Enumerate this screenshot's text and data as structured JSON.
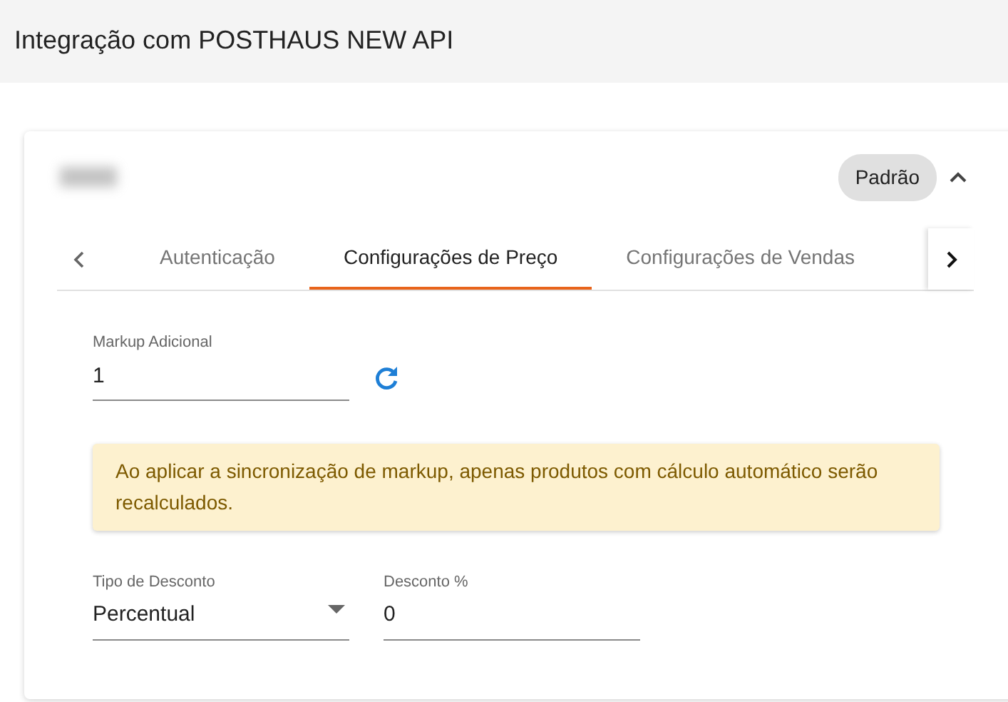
{
  "page": {
    "title": "Integração com POSTHAUS NEW API"
  },
  "card": {
    "badge": "Padrão",
    "expanded": true
  },
  "tabs": [
    {
      "label": "Autenticação",
      "selected": false
    },
    {
      "label": "Configurações de Preço",
      "selected": true
    },
    {
      "label": "Configurações de Vendas",
      "selected": false
    }
  ],
  "markup": {
    "label": "Markup Adicional",
    "value": "1"
  },
  "alert": {
    "text": "Ao aplicar a sincronização de markup, apenas produtos com cálculo automático serão recalculados."
  },
  "fields": [
    {
      "kind": "select",
      "label": "Tipo de Desconto",
      "value": "Percentual"
    },
    {
      "kind": "text",
      "label": "Desconto %",
      "value": "0"
    }
  ]
}
